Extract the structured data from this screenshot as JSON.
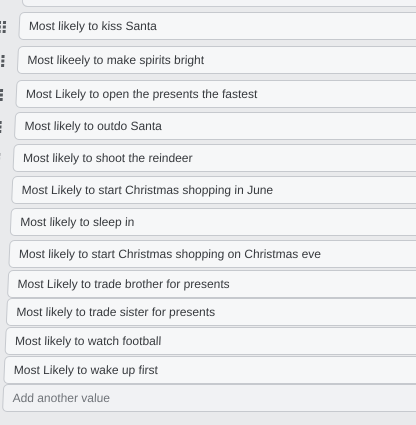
{
  "values": [
    "Most likely to kiss Santa",
    "Most likeely to make spirits bright",
    "Most Likely to open the presents the fastest",
    "Most likely to outdo Santa",
    "Most likely to shoot the reindeer",
    "Most Likely to start Christmas shopping in June",
    "Most likely to sleep in",
    "Most likely to start Christmas shopping on Christmas eve",
    "Most Likely to trade brother for presents",
    "Most likely to trade sister for presents",
    "Most likely to watch football",
    "Most Likely to wake up first"
  ],
  "add_value_placeholder": "Add another value",
  "icons": {
    "drag_handle": "drag-handle-icon"
  }
}
